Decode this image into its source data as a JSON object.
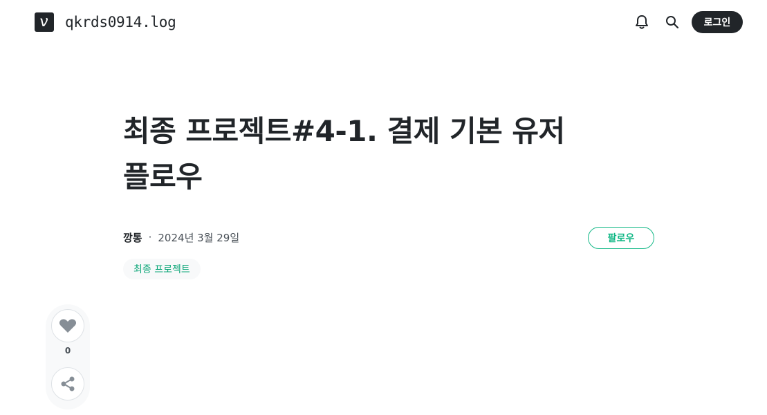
{
  "header": {
    "logo_letter": "v",
    "blog_name": "qkrds0914.log",
    "login_label": "로그인",
    "icons": [
      "bell-icon",
      "search-icon"
    ]
  },
  "post": {
    "title_line1": "최종 프로젝트#4-1. 결제 기본 유저",
    "title_line2": "플로우",
    "author": "깡통",
    "separator": "·",
    "date": "2024년 3월 29일",
    "follow_label": "팔로우",
    "tag": "최종 프로젝트"
  },
  "side": {
    "like_count": "0",
    "icons": [
      "heart-icon",
      "share-icon"
    ]
  },
  "colors": {
    "accent": "#12b886",
    "dark": "#212529",
    "muted": "#495057",
    "tag_bg": "#f8f9fa"
  }
}
